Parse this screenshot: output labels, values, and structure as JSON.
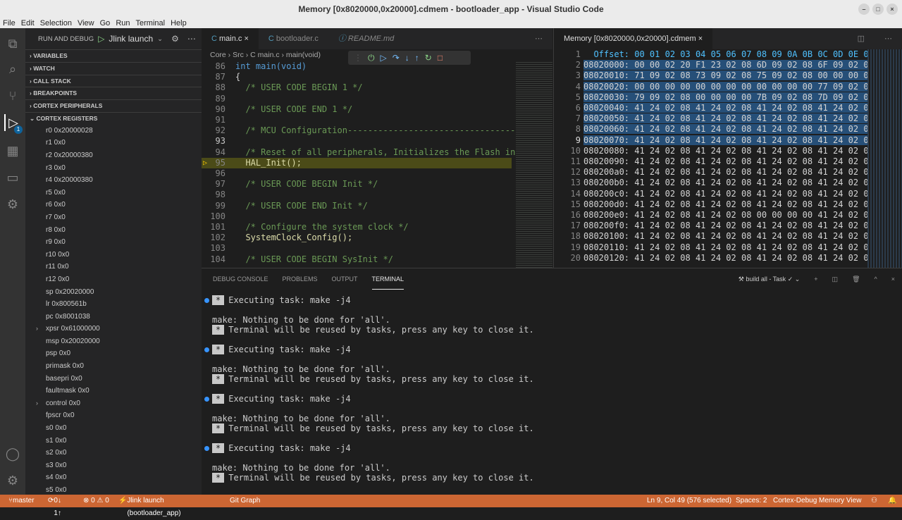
{
  "window": {
    "title": "Memory [0x8020000,0x20000].cdmem - bootloader_app - Visual Studio Code"
  },
  "menu": [
    "File",
    "Edit",
    "Selection",
    "View",
    "Go",
    "Run",
    "Terminal",
    "Help"
  ],
  "sidebar": {
    "header": "RUN AND DEBUG",
    "launch": "Jlink launch",
    "sections": [
      "VARIABLES",
      "WATCH",
      "CALL STACK",
      "BREAKPOINTS",
      "CORTEX PERIPHERALS",
      "CORTEX REGISTERS"
    ],
    "registers": [
      "r0 0x20000028",
      "r1 0x0",
      "r2 0x20000380",
      "r3 0x0",
      "r4 0x20000380",
      "r5 0x0",
      "r6 0x0",
      "r7 0x0",
      "r8 0x0",
      "r9 0x0",
      "r10 0x0",
      "r11 0x0",
      "r12 0x0",
      "sp 0x20020000",
      "lr 0x800561b",
      "pc 0x8001038",
      "xpsr 0x61000000",
      "msp 0x20020000",
      "psp 0x0",
      "primask 0x0",
      "basepri 0x0",
      "faultmask 0x0",
      "control 0x0",
      "fpscr 0x0",
      "s0 0x0",
      "s1 0x0",
      "s2 0x0",
      "s3 0x0",
      "s4 0x0",
      "s5 0x0"
    ],
    "badge": "1"
  },
  "editor": {
    "tabs": [
      "main.c",
      "bootloader.c",
      "README.md"
    ],
    "breadcrumb": "Core › Src › C main.c › main(void)",
    "lines": [
      {
        "n": "86",
        "t": "int main(void)"
      },
      {
        "n": "87",
        "t": "{"
      },
      {
        "n": "88",
        "t": "  /* USER CODE BEGIN 1 */"
      },
      {
        "n": "89",
        "t": ""
      },
      {
        "n": "90",
        "t": "  /* USER CODE END 1 */"
      },
      {
        "n": "91",
        "t": ""
      },
      {
        "n": "92",
        "t": "  /* MCU Configuration--------------------------------------"
      },
      {
        "n": "93",
        "t": ""
      },
      {
        "n": "94",
        "t": "  /* Reset of all peripherals, Initializes the Flash inte"
      },
      {
        "n": "95",
        "t": "  HAL_Init();"
      },
      {
        "n": "96",
        "t": ""
      },
      {
        "n": "97",
        "t": "  /* USER CODE BEGIN Init */"
      },
      {
        "n": "98",
        "t": ""
      },
      {
        "n": "99",
        "t": "  /* USER CODE END Init */"
      },
      {
        "n": "100",
        "t": ""
      },
      {
        "n": "101",
        "t": "  /* Configure the system clock */"
      },
      {
        "n": "102",
        "t": "  SystemClock_Config();"
      },
      {
        "n": "103",
        "t": ""
      },
      {
        "n": "104",
        "t": "  /* USER CODE BEGIN SysInit */"
      }
    ]
  },
  "memory": {
    "tab": "Memory [0x8020000,0x20000].cdmem",
    "rows": [
      {
        "n": "1",
        "t": "  Offset: 00 01 02 03 04 05 06 07 08 09 0A 0B 0C 0D 0E 0"
      },
      {
        "n": "2",
        "t": "08020000: 00 00 02 20 F1 23 02 08 6D 09 02 08 6F 09 02 0"
      },
      {
        "n": "3",
        "t": "08020010: 71 09 02 08 73 09 02 08 75 09 02 08 00 00 00 0"
      },
      {
        "n": "4",
        "t": "08020020: 00 00 00 00 00 00 00 00 00 00 00 00 77 09 02 0"
      },
      {
        "n": "5",
        "t": "08020030: 79 09 02 08 00 00 00 00 7B 09 02 08 7D 09 02 0"
      },
      {
        "n": "6",
        "t": "08020040: 41 24 02 08 41 24 02 08 41 24 02 08 41 24 02 0"
      },
      {
        "n": "7",
        "t": "08020050: 41 24 02 08 41 24 02 08 41 24 02 08 41 24 02 0"
      },
      {
        "n": "8",
        "t": "08020060: 41 24 02 08 41 24 02 08 41 24 02 08 41 24 02 0"
      },
      {
        "n": "9",
        "t": "08020070: 41 24 02 08 41 24 02 08 41 24 02 08 41 24 02 0"
      },
      {
        "n": "10",
        "t": "08020080: 41 24 02 08 41 24 02 08 41 24 02 08 41 24 02 0"
      },
      {
        "n": "11",
        "t": "08020090: 41 24 02 08 41 24 02 08 41 24 02 08 41 24 02 0"
      },
      {
        "n": "12",
        "t": "080200a0: 41 24 02 08 41 24 02 08 41 24 02 08 41 24 02 0"
      },
      {
        "n": "13",
        "t": "080200b0: 41 24 02 08 41 24 02 08 41 24 02 08 41 24 02 0"
      },
      {
        "n": "14",
        "t": "080200c0: 41 24 02 08 41 24 02 08 41 24 02 08 41 24 02 0"
      },
      {
        "n": "15",
        "t": "080200d0: 41 24 02 08 41 24 02 08 41 24 02 08 41 24 02 0"
      },
      {
        "n": "16",
        "t": "080200e0: 41 24 02 08 41 24 02 08 00 00 00 00 41 24 02 0"
      },
      {
        "n": "17",
        "t": "080200f0: 41 24 02 08 41 24 02 08 41 24 02 08 41 24 02 0"
      },
      {
        "n": "18",
        "t": "08020100: 41 24 02 08 41 24 02 08 41 24 02 08 41 24 02 0"
      },
      {
        "n": "19",
        "t": "08020110: 41 24 02 08 41 24 02 08 41 24 02 08 41 24 02 0"
      },
      {
        "n": "20",
        "t": "08020120: 41 24 02 08 41 24 02 08 41 24 02 08 41 24 02 0"
      }
    ]
  },
  "panel": {
    "tabs": [
      "DEBUG CONSOLE",
      "PROBLEMS",
      "OUTPUT",
      "TERMINAL"
    ],
    "task": "build all - Task",
    "exec": "Executing task: make -j4",
    "make": "make: Nothing to be done for 'all'.",
    "reuse": "Terminal will be reused by tasks, press any key to close it."
  },
  "status": {
    "branch": "master",
    "sync": "0↓ 1↑",
    "errors": "⊗ 0 ⚠ 0",
    "launch": "Jlink launch (bootloader_app)",
    "git": "Git Graph",
    "pos": "Ln 9, Col 49 (576 selected)",
    "spaces": "Spaces: 2",
    "mode": "Cortex-Debug Memory View"
  }
}
